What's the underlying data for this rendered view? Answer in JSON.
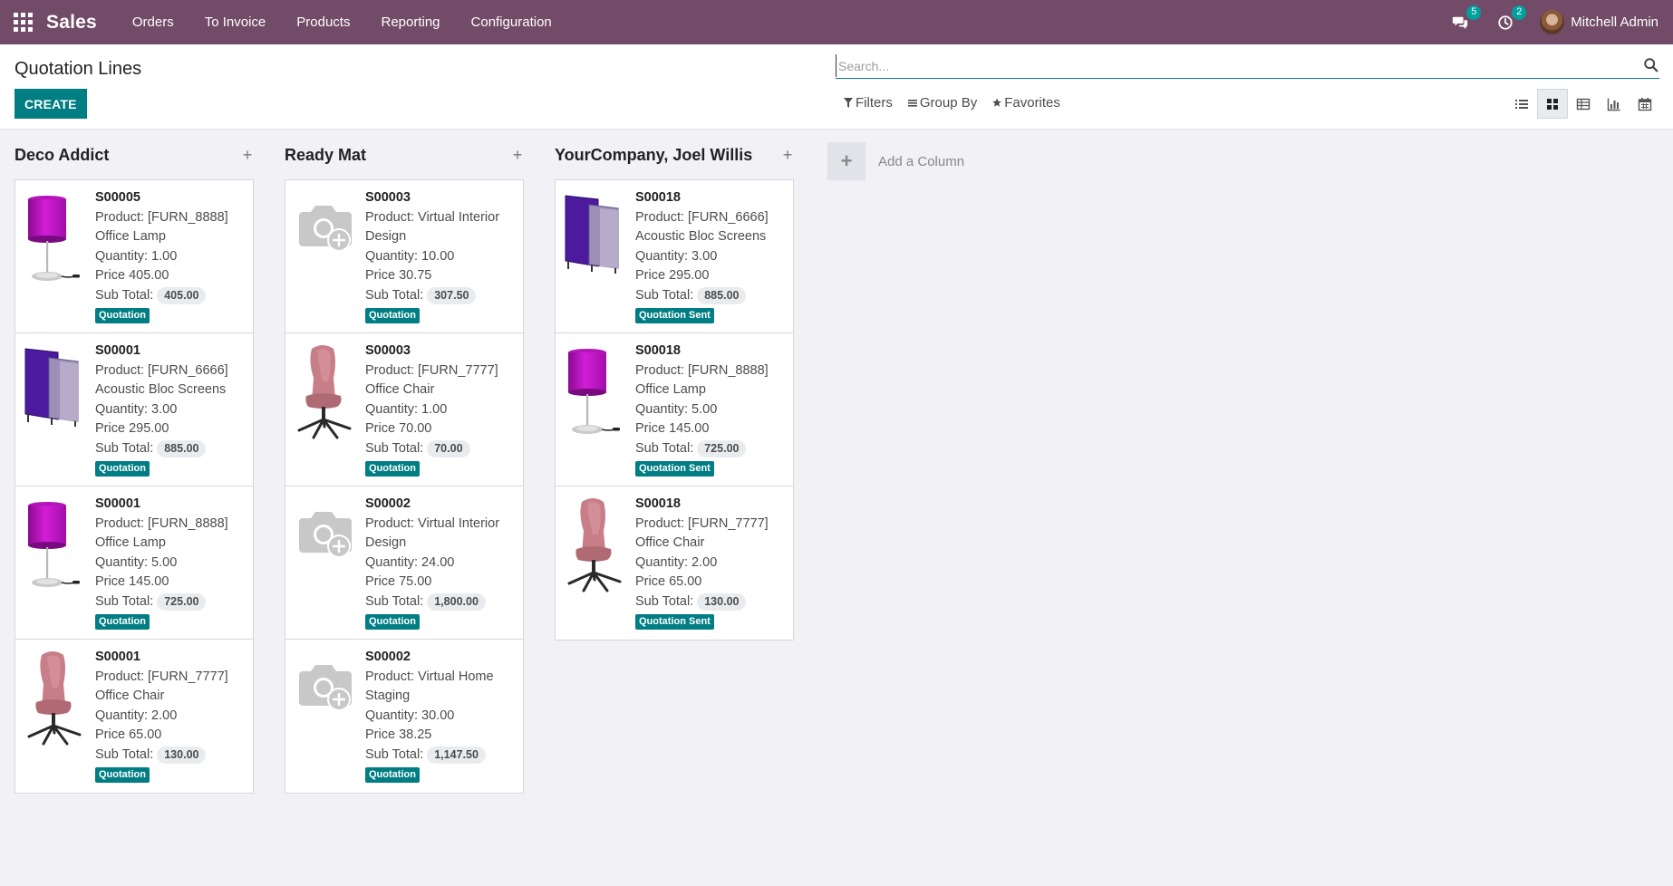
{
  "navbar": {
    "brand": "Sales",
    "menu": [
      "Orders",
      "To Invoice",
      "Products",
      "Reporting",
      "Configuration"
    ],
    "messages_count": "5",
    "activities_count": "2",
    "user_name": "Mitchell Admin",
    "color": "#714b67"
  },
  "control_panel": {
    "title": "Quotation Lines",
    "create_label": "CREATE",
    "search_placeholder": "Search...",
    "filters_label": "Filters",
    "group_by_label": "Group By",
    "favorites_label": "Favorites",
    "views": [
      "list-view-icon",
      "kanban-view-icon",
      "pivot-view-icon",
      "graph-view-icon",
      "calendar-view-icon"
    ],
    "active_view": "kanban-view-icon",
    "accent": "#017e84"
  },
  "kanban": {
    "add_column_label": "Add a Column",
    "columns": [
      {
        "title": "Deco Addict",
        "cards": [
          {
            "ref": "S00005",
            "product_l1": "Product: [FURN_8888]",
            "product_l2": "Office Lamp",
            "quantity": "Quantity: 1.00",
            "price": "Price 405.00",
            "subtotal_label": "Sub Total:",
            "subtotal": "405.00",
            "status": "Quotation",
            "image": "lamp"
          },
          {
            "ref": "S00001",
            "product_l1": "Product: [FURN_6666]",
            "product_l2": "Acoustic Bloc Screens",
            "quantity": "Quantity: 3.00",
            "price": "Price 295.00",
            "subtotal_label": "Sub Total:",
            "subtotal": "885.00",
            "status": "Quotation",
            "image": "screens"
          },
          {
            "ref": "S00001",
            "product_l1": "Product: [FURN_8888]",
            "product_l2": "Office Lamp",
            "quantity": "Quantity: 5.00",
            "price": "Price 145.00",
            "subtotal_label": "Sub Total:",
            "subtotal": "725.00",
            "status": "Quotation",
            "image": "lamp"
          },
          {
            "ref": "S00001",
            "product_l1": "Product: [FURN_7777]",
            "product_l2": "Office Chair",
            "quantity": "Quantity: 2.00",
            "price": "Price 65.00",
            "subtotal_label": "Sub Total:",
            "subtotal": "130.00",
            "status": "Quotation",
            "image": "chair"
          }
        ]
      },
      {
        "title": "Ready Mat",
        "cards": [
          {
            "ref": "S00003",
            "product_l1": "Product: Virtual Interior",
            "product_l2": "Design",
            "quantity": "Quantity: 10.00",
            "price": "Price 30.75",
            "subtotal_label": "Sub Total:",
            "subtotal": "307.50",
            "status": "Quotation",
            "image": "placeholder"
          },
          {
            "ref": "S00003",
            "product_l1": "Product: [FURN_7777]",
            "product_l2": "Office Chair",
            "quantity": "Quantity: 1.00",
            "price": "Price 70.00",
            "subtotal_label": "Sub Total:",
            "subtotal": "70.00",
            "status": "Quotation",
            "image": "chair"
          },
          {
            "ref": "S00002",
            "product_l1": "Product: Virtual Interior",
            "product_l2": "Design",
            "quantity": "Quantity: 24.00",
            "price": "Price 75.00",
            "subtotal_label": "Sub Total:",
            "subtotal": "1,800.00",
            "status": "Quotation",
            "image": "placeholder"
          },
          {
            "ref": "S00002",
            "product_l1": "Product: Virtual Home",
            "product_l2": "Staging",
            "quantity": "Quantity: 30.00",
            "price": "Price 38.25",
            "subtotal_label": "Sub Total:",
            "subtotal": "1,147.50",
            "status": "Quotation",
            "image": "placeholder"
          }
        ]
      },
      {
        "title": "YourCompany, Joel Willis",
        "cards": [
          {
            "ref": "S00018",
            "product_l1": "Product: [FURN_6666]",
            "product_l2": "Acoustic Bloc Screens",
            "quantity": "Quantity: 3.00",
            "price": "Price 295.00",
            "subtotal_label": "Sub Total:",
            "subtotal": "885.00",
            "status": "Quotation Sent",
            "image": "screens"
          },
          {
            "ref": "S00018",
            "product_l1": "Product: [FURN_8888]",
            "product_l2": "Office Lamp",
            "quantity": "Quantity: 5.00",
            "price": "Price 145.00",
            "subtotal_label": "Sub Total:",
            "subtotal": "725.00",
            "status": "Quotation Sent",
            "image": "lamp"
          },
          {
            "ref": "S00018",
            "product_l1": "Product: [FURN_7777]",
            "product_l2": "Office Chair",
            "quantity": "Quantity: 2.00",
            "price": "Price 65.00",
            "subtotal_label": "Sub Total:",
            "subtotal": "130.00",
            "status": "Quotation Sent",
            "image": "chair"
          }
        ]
      }
    ]
  }
}
